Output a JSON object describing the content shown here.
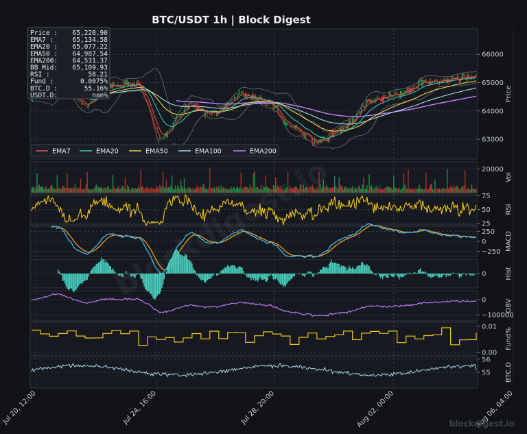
{
  "title": "BTC/USDT  1h  |  Block Digest",
  "watermark_diagonal": "blockdigest.io",
  "watermark_corner": "blockdigest.io",
  "colors": {
    "background": "#111318",
    "panel": "#161a20",
    "up": "#2e9e55",
    "down": "#c0392b",
    "ema7": "#e5534b",
    "ema20": "#3fc1b5",
    "ema50": "#f0d24a",
    "ema100": "#a9d8ea",
    "ema200": "#c77dff",
    "rsi": "#f5c518",
    "macd": "#3fb7f0",
    "signal": "#f39c12",
    "hist": "#48d1c0",
    "obv": "#c77dff",
    "fund": "#f5c518",
    "btcd": "#a9d8ea"
  },
  "info_box": [
    {
      "label": "Price :",
      "value": "65,228.90"
    },
    {
      "label": "EMA7  :",
      "value": "65,134.58"
    },
    {
      "label": "EMA20 :",
      "value": "65,077.22"
    },
    {
      "label": "EMA50 :",
      "value": "64,987.54"
    },
    {
      "label": "EMA200:",
      "value": "64,531.37"
    },
    {
      "label": "BB Mid:",
      "value": "65,109.93"
    },
    {
      "label": "RSI   :",
      "value": "58.21"
    },
    {
      "label": "Fund  :",
      "value": "0.0075%"
    },
    {
      "label": "BTC.D :",
      "value": "55.16%"
    },
    {
      "label": "USDT.D:",
      "value": "nan%"
    }
  ],
  "chart_data": {
    "type": "line",
    "x_tick_labels": [
      "Jul 20, 12:00",
      "Jul 24, 16:00",
      "Jul 28, 20:00",
      "Aug 02, 00:00",
      "Aug 06, 04:00"
    ],
    "legend": [
      "EMA7",
      "EMA20",
      "EMA50",
      "EMA100",
      "EMA200"
    ],
    "panels": [
      {
        "name": "Price",
        "ylabel": "Price",
        "ylim": [
          62300,
          66900
        ],
        "yticks": [
          63000,
          64000,
          65000,
          66000
        ],
        "close_anchors": [
          64500,
          65300,
          64200,
          64900,
          65000,
          63100,
          64200,
          63900,
          64600,
          64300,
          63400,
          62900,
          63500,
          64400,
          64600,
          65000,
          65100,
          65230
        ]
      },
      {
        "name": "Vol",
        "ylabel": "Vol",
        "ylim": [
          0,
          26000
        ],
        "yticks": [
          20000
        ]
      },
      {
        "name": "RSI",
        "ylabel": "RSI",
        "ylim": [
          22,
          78
        ],
        "yticks": [
          25,
          50,
          75
        ]
      },
      {
        "name": "MACD",
        "ylabel": "MACD",
        "ylim": [
          -380,
          380
        ],
        "yticks": [
          -250,
          0,
          250
        ]
      },
      {
        "name": "Hist",
        "ylabel": "Hist",
        "ylim": [
          -200,
          200
        ],
        "yticks": [
          0
        ]
      },
      {
        "name": "OBV",
        "ylabel": "OBV",
        "ylim": [
          -140000,
          60000
        ],
        "yticks": [
          -100000,
          0
        ]
      },
      {
        "name": "Fund%",
        "ylabel": "Fund%",
        "ylim": [
          -0.001,
          0.0115
        ],
        "yticks": [
          0.0,
          0.01
        ]
      },
      {
        "name": "BTC.D",
        "ylabel": "BTC.D",
        "ylim": [
          53.8,
          56.2
        ],
        "yticks": [
          55,
          56
        ]
      }
    ],
    "grid": true,
    "legend_placement": "lower-left"
  }
}
